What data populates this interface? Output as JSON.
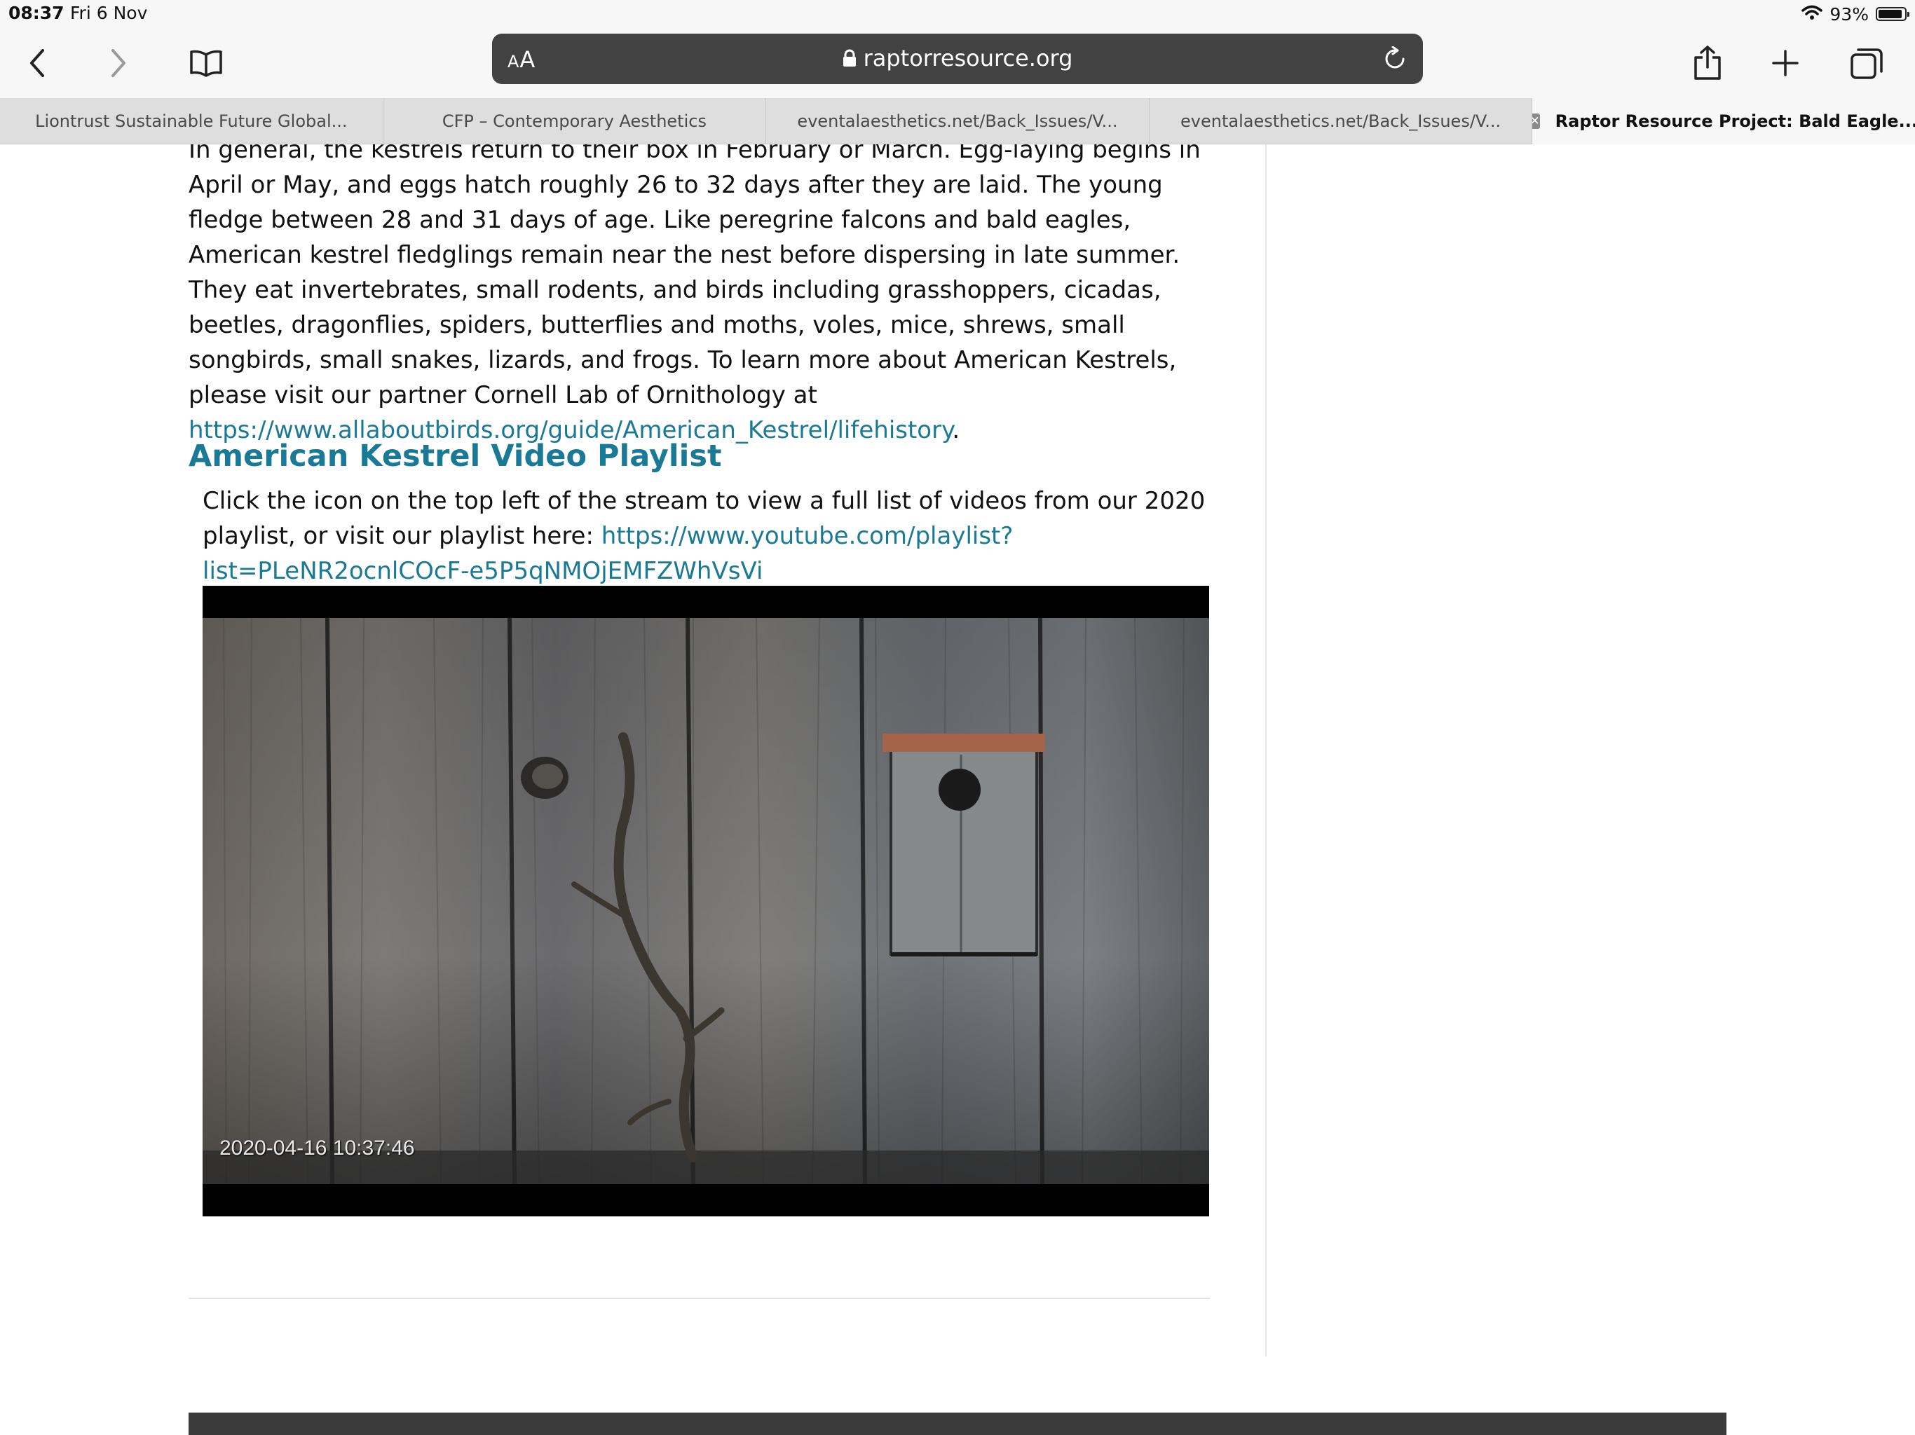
{
  "status_bar": {
    "time": "08:37",
    "date": "Fri 6 Nov",
    "battery": "93%",
    "battery_level": 0.93,
    "icons": [
      "wifi-icon",
      "battery-icon"
    ]
  },
  "toolbar": {
    "text_size_label_small": "A",
    "text_size_label_large": "A",
    "url": "raptorresource.org",
    "icons": [
      "back-icon",
      "forward-icon",
      "bookmarks-icon",
      "lock-icon",
      "reload-icon",
      "share-icon",
      "new-tab-icon",
      "tabs-icon"
    ]
  },
  "tabs": [
    {
      "label": "Liontrust Sustainable Future Global..."
    },
    {
      "label": "CFP – Contemporary Aesthetics"
    },
    {
      "label": "eventalaesthetics.net/Back_Issues/V..."
    },
    {
      "label": "eventalaesthetics.net/Back_Issues/V..."
    },
    {
      "label": "Raptor Resource Project: Bald Eagle..."
    }
  ],
  "article": {
    "paragraph_text": "In general, the kestrels return to their box in February or March. Egg-laying begins in April or May, and eggs hatch roughly 26 to 32 days after they are laid. The young fledge between 28 and 31 days of age. Like peregrine falcons and bald eagles, American kestrel fledglings remain near the nest before dispersing in late summer. They eat invertebrates, small rodents, and birds including grasshoppers, cicadas, beetles, dragonflies, spiders, butterflies and moths, voles, mice, shrews, small songbirds, small snakes, lizards, and frogs. To learn more about American Kestrels, please visit our partner Cornell Lab of Ornithology at ",
    "paragraph_link": "https://www.allaboutbirds.org/guide/American_Kestrel/lifehistory",
    "paragraph_end": ".",
    "heading": "American Kestrel Video Playlist",
    "playlist_text": "Click the icon on the top left of the stream to view a full list of videos from our 2020 playlist, or visit our playlist here: ",
    "playlist_link_line1": "https://www.youtube.com/playlist?",
    "playlist_link_line2": "list=PLeNR2ocnlCOcF-e5P5qNMOjEMFZWhVsVi",
    "video_timestamp": "2020-04-16 10:37:46"
  },
  "colors": {
    "link": "#1a7a96",
    "url_bar": "#424242",
    "toolbar_bg": "#f7f7f7",
    "tab_bg": "#dedede"
  }
}
